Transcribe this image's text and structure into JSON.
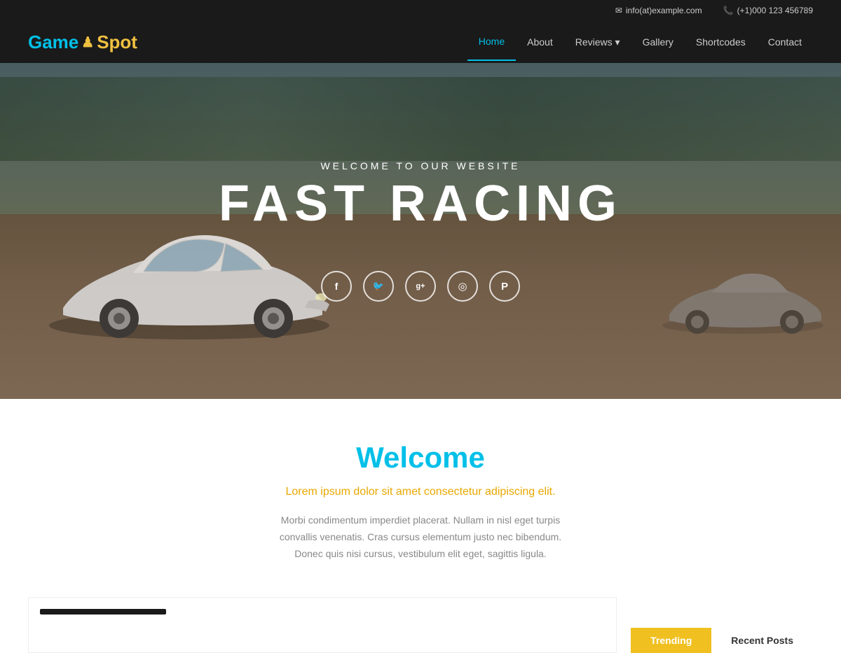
{
  "topbar": {
    "email_icon": "✉",
    "email": "info(at)example.com",
    "phone_icon": "📞",
    "phone": "(+1)000 123 456789"
  },
  "logo": {
    "game": "Game",
    "icon": "♟",
    "spot": "Spot"
  },
  "nav": {
    "items": [
      {
        "label": "Home",
        "active": true
      },
      {
        "label": "About",
        "active": false
      },
      {
        "label": "Reviews",
        "active": false,
        "dropdown": true
      },
      {
        "label": "Gallery",
        "active": false
      },
      {
        "label": "Shortcodes",
        "active": false
      },
      {
        "label": "Contact",
        "active": false
      }
    ]
  },
  "hero": {
    "subtitle": "WELCOME TO OUR WEBSITE",
    "title": "FAST RACING"
  },
  "social": {
    "icons": [
      {
        "name": "facebook",
        "symbol": "f"
      },
      {
        "name": "twitter",
        "symbol": "t"
      },
      {
        "name": "google-plus",
        "symbol": "g+"
      },
      {
        "name": "instagram",
        "symbol": "📷"
      },
      {
        "name": "pinterest",
        "symbol": "p"
      }
    ]
  },
  "welcome": {
    "title": "Welcome",
    "subtitle": "Lorem ipsum dolor sit amet consectetur adipiscing elit.",
    "body": "Morbi condimentum imperdiet placerat. Nullam in nisl eget turpis convallis venenatis. Cras cursus elementum justo nec bibendum. Donec quis nisi cursus, vestibulum elit eget, sagittis ligula."
  },
  "tabs": {
    "trending_label": "Trending",
    "recent_label": "Recent Posts"
  },
  "colors": {
    "accent_blue": "#00c0e8",
    "accent_yellow": "#f0c020",
    "text_gray": "#888888",
    "text_orange": "#e8a800"
  }
}
